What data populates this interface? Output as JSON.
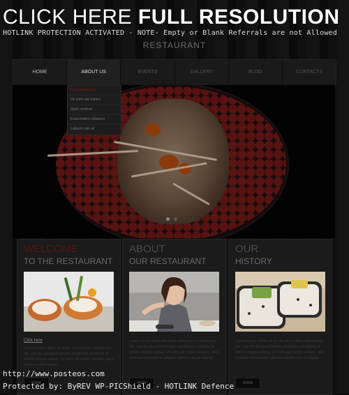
{
  "watermark": {
    "title_normal": "CLICK HERE ",
    "title_bold": "FULL RESOLUTION",
    "subtitle": "HOTLINK PROTECTION ACTIVATED - NOTE- Empty or Blank Referrals are not Allowed",
    "footer_url": "http://www.posteos.com",
    "footer_text": "Protected by: ByREV WP-PICShield - HOTLINK Defence"
  },
  "logo": {
    "subtitle": "RESTAURANT"
  },
  "nav": {
    "items": [
      {
        "label": "HOME"
      },
      {
        "label": "ABOUT US"
      },
      {
        "label": "EVENTS"
      },
      {
        "label": "GALLERY"
      },
      {
        "label": "BLOG"
      },
      {
        "label": "CONTACTS"
      }
    ],
    "dropdown": [
      {
        "label": "Our restaurant"
      },
      {
        "label": "Ut enim ad minim"
      },
      {
        "label": "Quis nostrud"
      },
      {
        "label": "Exercitation ullamco"
      },
      {
        "label": "Laboris nisi ut"
      }
    ]
  },
  "boxes": [
    {
      "title1": "WELCOME",
      "title2": "TO THE RESTAURANT",
      "link": "Click here",
      "text": "Lorem ipsum dolor sit amet, consectetur adipisicing elit, sed do eiusmod tempor incididunt ut labore et dolore magna aliqua. Ut enim ad minim veniam, quis nostrud exercitation.",
      "button": "more"
    },
    {
      "title1": "ABOUT",
      "title2": "OUR RESTAURANT",
      "text": "Lorem ipsum dolor sit amet, consectetur adipisicing elit, sed do eiusmod tempor incididunt ut labore et dolore magna aliqua. Ut enim ad minim veniam, quis nostrud exercitation ullamco laboris nisi ut aliquip.",
      "button": "more"
    },
    {
      "title1": "OUR",
      "title2": "HISTORY",
      "text": "Lorem ipsum dolor sit amet, consectetur adipisicing elit, sed do eiusmod tempor incididunt ut labore et dolore magna aliqua. Ut enim ad minim veniam, quis nostrud exercitation ullamco laboris nisi ut aliquip.",
      "button": "more"
    }
  ],
  "colors": {
    "accent": "#6a1515",
    "background": "#0d0d0d"
  }
}
